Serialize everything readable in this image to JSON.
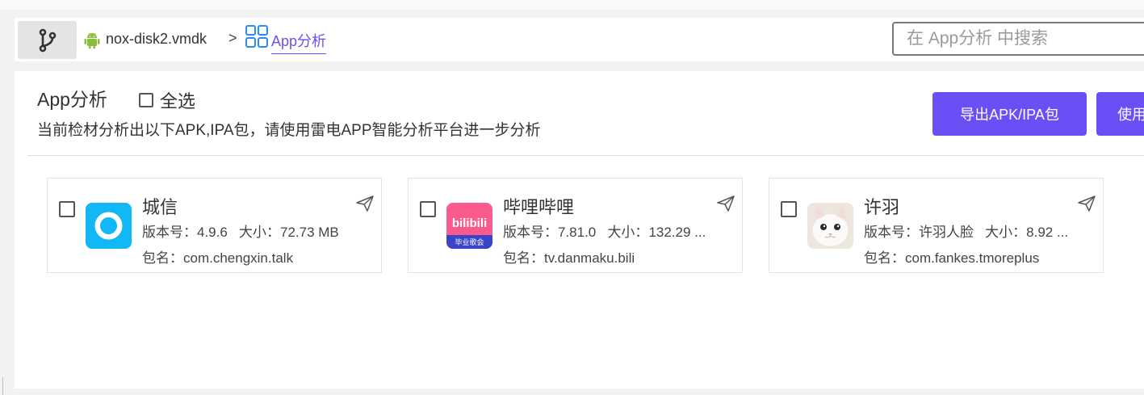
{
  "header": {
    "disk_name": "nox-disk2.vmdk",
    "separator": ">",
    "current": "App分析",
    "search_placeholder": "在 App分析 中搜索"
  },
  "panel": {
    "title": "App分析",
    "select_all": "全选",
    "description": "当前检材分析出以下APK,IPA包，请使用雷电APP智能分析平台进一步分析",
    "export_button": "导出APK/IPA包",
    "use_button": "使用"
  },
  "apps": [
    {
      "name": "城信",
      "version_label": "版本号：",
      "version": "4.9.6",
      "size_label": "大小：",
      "size": "72.73 MB",
      "pkg_label": "包名：",
      "package": "com.chengxin.talk",
      "icon": "chengxin-app-icon"
    },
    {
      "name": "哔哩哔哩",
      "version_label": "版本号：",
      "version": "7.81.0",
      "size_label": "大小：",
      "size": "132.29 ...",
      "pkg_label": "包名：",
      "package": "tv.danmaku.bili",
      "icon": "bilibili-app-icon",
      "icon_text_top": "bilibili",
      "icon_text_bottom": "毕业歌会"
    },
    {
      "name": "许羽",
      "version_label": "版本号：",
      "version": "许羽人脸",
      "size_label": "大小：",
      "size": "8.92 ...",
      "pkg_label": "包名：",
      "package": "com.fankes.tmoreplus",
      "icon": "cat-photo-app-icon"
    }
  ],
  "colors": {
    "accent": "#6c4ef5",
    "chengxin": "#12b7f5",
    "bilibili": "#fb5b8c"
  }
}
